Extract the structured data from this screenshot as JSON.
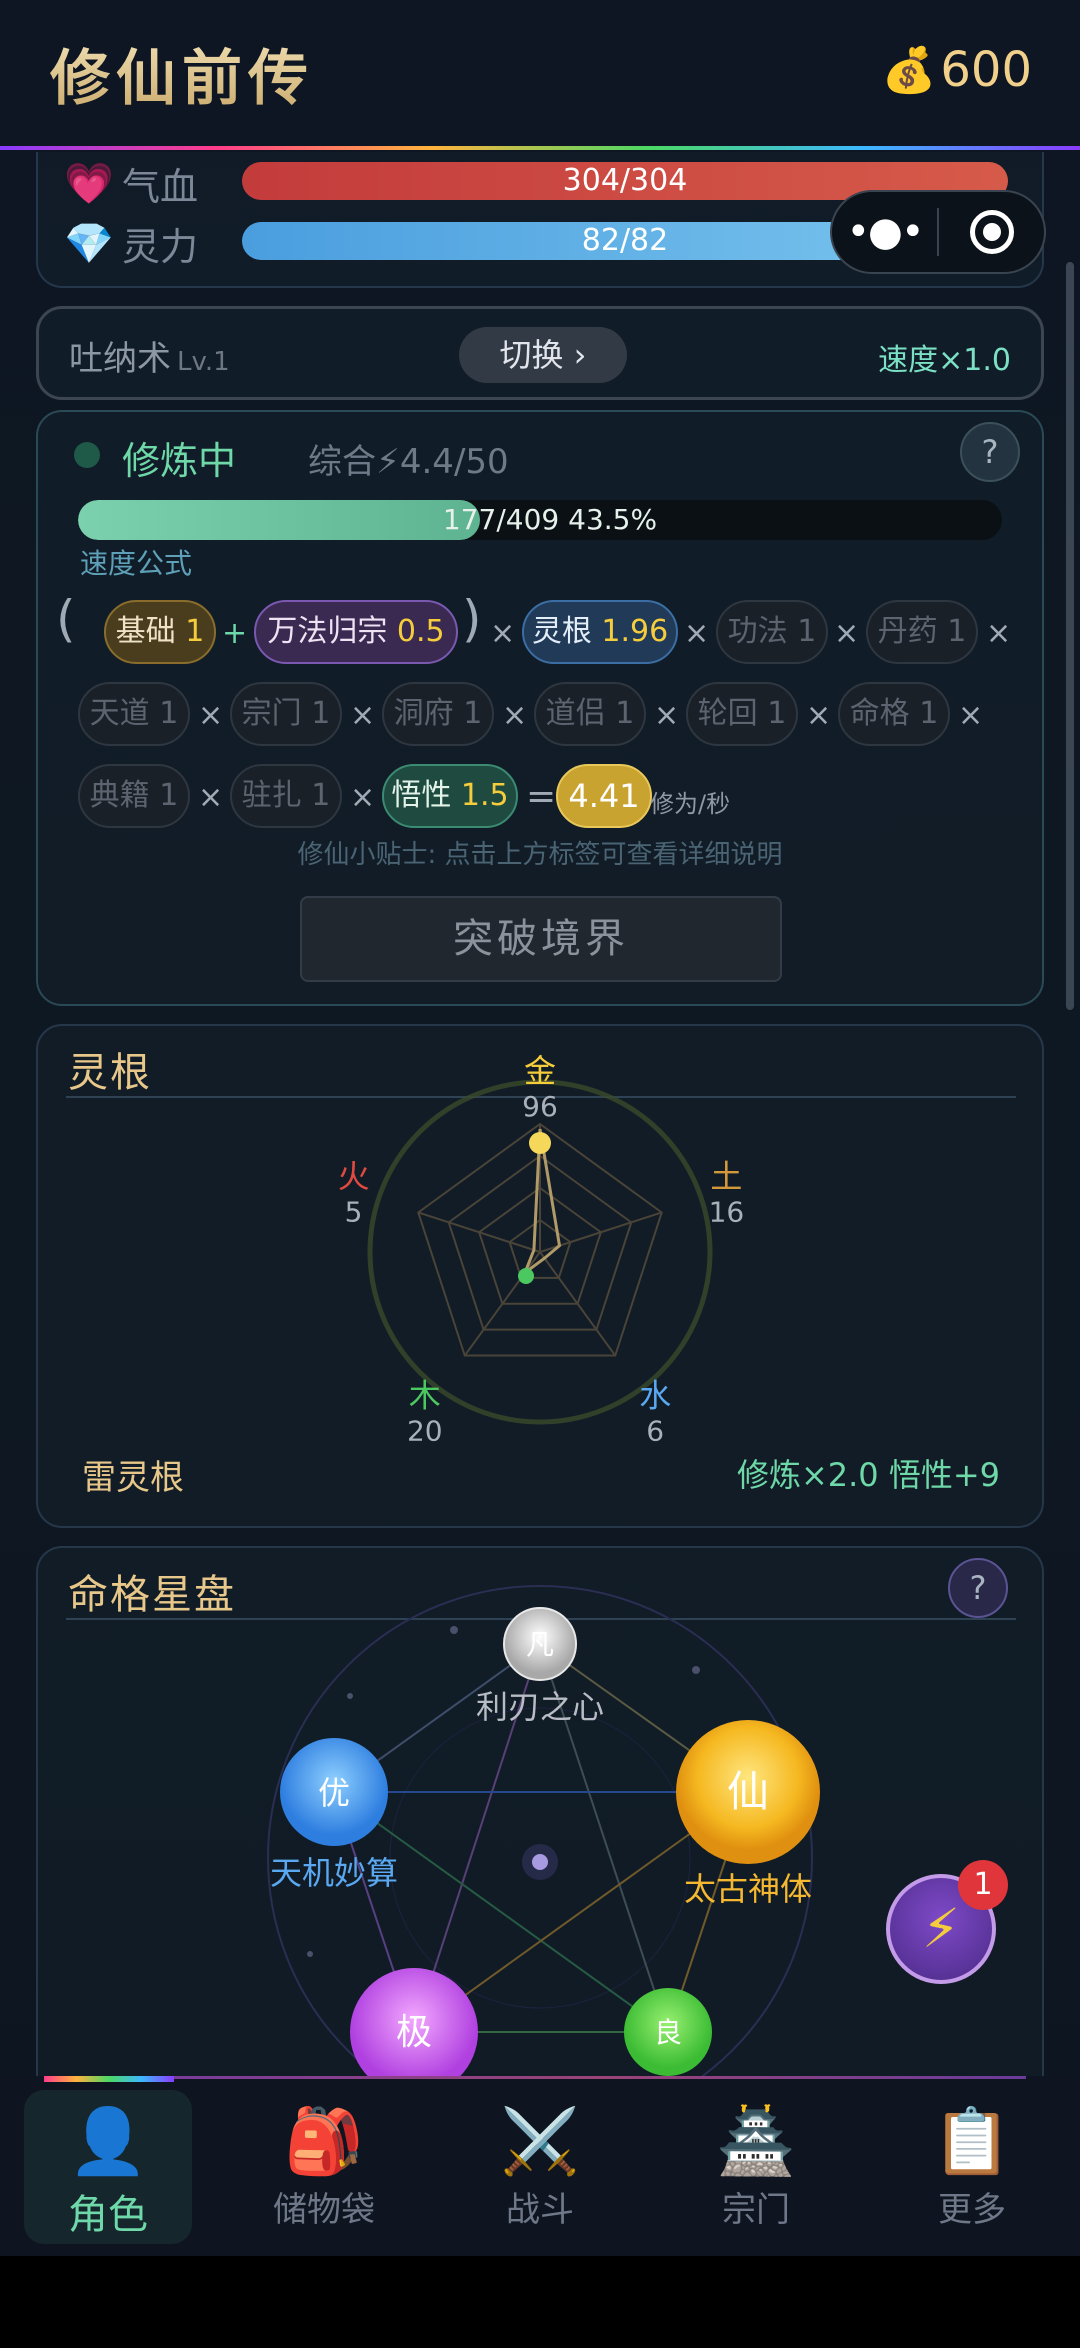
{
  "header": {
    "title": "修仙前传",
    "coins": "600"
  },
  "stats": {
    "hp": {
      "label": "气血",
      "value": "304/304",
      "ratio": 1.0
    },
    "mp": {
      "label": "灵力",
      "value": "82/82",
      "ratio": 1.0
    }
  },
  "technique": {
    "name": "吐纳术",
    "level": "Lv.1",
    "switch_label": "切换 ›",
    "speed": "速度×1.0"
  },
  "cultivation": {
    "status": "修炼中",
    "overall": "综合⚡4.4/50",
    "help": "?",
    "progress_text": "177/409  43.5%",
    "progress_fraction": 0.435,
    "formula_label": "速度公式",
    "chips": {
      "base": {
        "label": "基础",
        "value": "1"
      },
      "wanfa": {
        "label": "万法归宗",
        "value": "0.5"
      },
      "linggen": {
        "label": "灵根",
        "value": "1.96"
      },
      "gongfa": {
        "label": "功法",
        "value": "1"
      },
      "danyao": {
        "label": "丹药",
        "value": "1"
      },
      "tiandao": {
        "label": "天道",
        "value": "1"
      },
      "zongmen": {
        "label": "宗门",
        "value": "1"
      },
      "dongfu": {
        "label": "洞府",
        "value": "1"
      },
      "daolv": {
        "label": "道侣",
        "value": "1"
      },
      "lunhui": {
        "label": "轮回",
        "value": "1"
      },
      "mingge": {
        "label": "命格",
        "value": "1"
      },
      "dianji": {
        "label": "典籍",
        "value": "1"
      },
      "zhuzha": {
        "label": "驻扎",
        "value": "1"
      },
      "wuxing": {
        "label": "悟性",
        "value": "1.5"
      }
    },
    "result": "4.41",
    "unit": "修为/秒",
    "tip": "修仙小贴士: 点击上方标签可查看详细说明",
    "breakthrough": "突破境界"
  },
  "spirit_root": {
    "title": "灵根",
    "elements": [
      {
        "name": "金",
        "value": "96",
        "color": "#f5cd3c"
      },
      {
        "name": "土",
        "value": "16",
        "color": "#d49a3a"
      },
      {
        "name": "水",
        "value": "6",
        "color": "#5aa8f0"
      },
      {
        "name": "木",
        "value": "20",
        "color": "#4cc860"
      },
      {
        "name": "火",
        "value": "5",
        "color": "#e04a40"
      }
    ],
    "type": "雷灵根",
    "bonus": "修炼×2.0  悟性+9"
  },
  "star_chart": {
    "title": "命格星盘",
    "help": "?",
    "nodes": {
      "fan": {
        "glyph": "凡",
        "label": "利刃之心"
      },
      "you": {
        "glyph": "优",
        "label": "天机妙算"
      },
      "xian": {
        "glyph": "仙",
        "label": "太古神体"
      },
      "ji": {
        "glyph": "极"
      },
      "liang": {
        "glyph": "良"
      }
    }
  },
  "fab": {
    "icon": "⚡",
    "badge": "1"
  },
  "tabs": [
    {
      "icon": "👤",
      "label": "角色"
    },
    {
      "icon": "🎒",
      "label": "储物袋"
    },
    {
      "icon": "⚔️",
      "label": "战斗"
    },
    {
      "icon": "🏯",
      "label": "宗门"
    },
    {
      "icon": "📋",
      "label": "更多"
    }
  ]
}
